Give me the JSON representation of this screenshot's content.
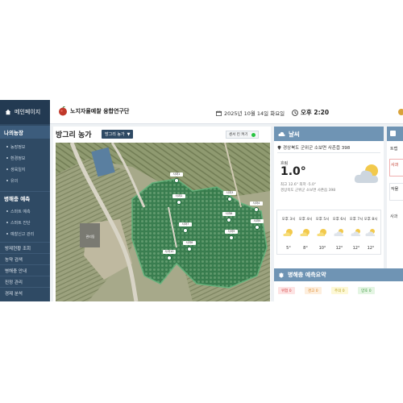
{
  "sidebar": {
    "home": "메인페이지",
    "group1": "나의농장",
    "group1_items": [
      "농장정보",
      "환경정보",
      "생육일지",
      "유의"
    ],
    "group2": "병해충 예측",
    "group2_items": [
      "스마트 예측",
      "스마트 진단",
      "예찰신고 관리"
    ],
    "items": [
      "방제현황 조회",
      "농약 검색",
      "병해충 안내",
      "진정 관리",
      "경제 분석"
    ]
  },
  "header": {
    "org": "노지자율예찰 융합연구단",
    "date": "2025년 10월 14일 화요일",
    "time": "오후 2:20"
  },
  "map_panel": {
    "title": "방그리 농가",
    "select_label": "방그리 농가",
    "sensor_label": "센서 킨 켜기"
  },
  "weather": {
    "title": "날씨",
    "location": "경상북도 군위군 소보면 사촌읍 398",
    "condition": "흐림",
    "temp": "1.0°",
    "range": "최고 12.6° 최저 -5.0°",
    "station": "경상북도 군위군 소보면 사촌읍 398",
    "forecast": [
      {
        "time": "오후 3시",
        "temp": "5°",
        "icon": "sun-cloud-icon"
      },
      {
        "time": "오후 4시",
        "temp": "8°",
        "icon": "sun-cloud-icon"
      },
      {
        "time": "오후 5시",
        "temp": "10°",
        "icon": "sun-cloud-icon"
      },
      {
        "time": "오후 6시",
        "temp": "12°",
        "icon": "partly-cloudy-icon"
      },
      {
        "time": "오후 7시",
        "temp": "12°",
        "icon": "partly-cloudy-icon"
      },
      {
        "time": "오후 8시",
        "temp": "12°",
        "icon": "partly-cloudy-icon"
      }
    ]
  },
  "pest": {
    "title": "병해충 예측요약",
    "badges": [
      {
        "label": "위험 0",
        "bg": "#fde3e3",
        "fg": "#d64545"
      },
      {
        "label": "경고 0",
        "bg": "#fdeedd",
        "fg": "#e08a2a"
      },
      {
        "label": "주의 0",
        "bg": "#fdf8d6",
        "fg": "#b9a21a"
      },
      {
        "label": "양호 0",
        "bg": "#e4f5e3",
        "fg": "#3d9a3d"
      }
    ]
  },
  "right_panel": {
    "lines": [
      "트랩",
      "사과",
      "작물",
      "사과"
    ]
  },
  "map_markers": [
    "사과1",
    "사과2",
    "사과3",
    "사과4",
    "사과5",
    "사과6",
    "사과7",
    "사과8",
    "사과9",
    "사과10"
  ],
  "map_building_label": "관리동",
  "colors": {
    "sidebar": "#2f4a64",
    "panel_head": "#6f94b4",
    "orchard": "#2f7a4a",
    "accent_green": "#28c440"
  }
}
